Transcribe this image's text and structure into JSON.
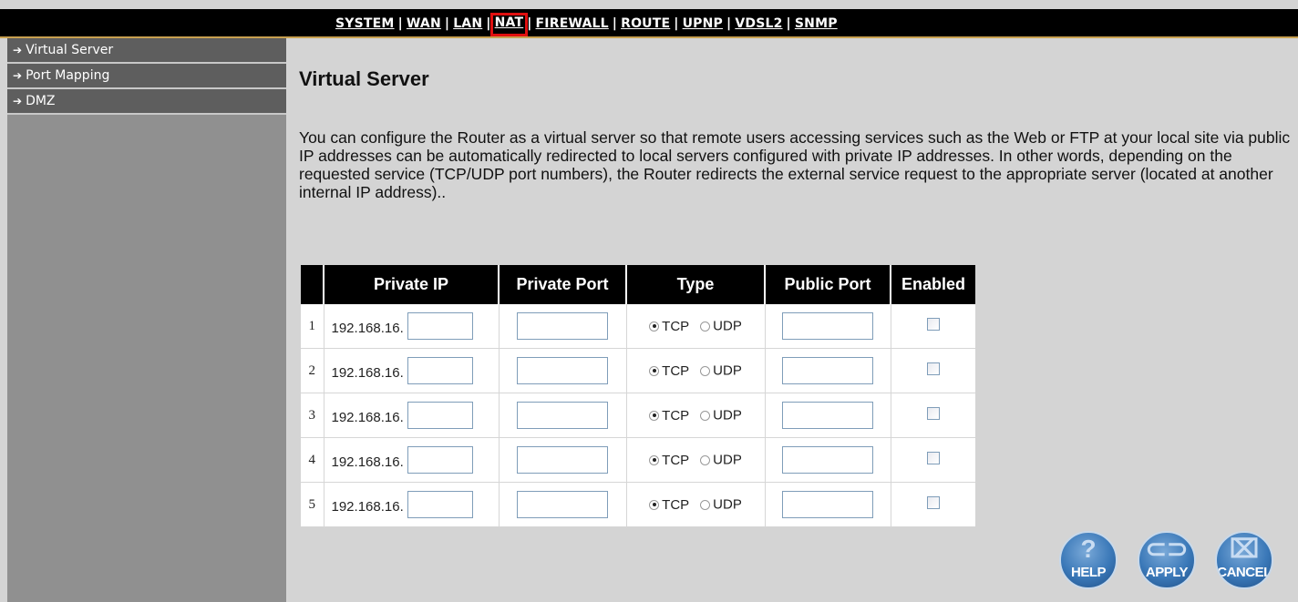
{
  "topnav": {
    "items": [
      "SYSTEM",
      "WAN",
      "LAN",
      "NAT",
      "FIREWALL",
      "ROUTE",
      "UPNP",
      "VDSL2",
      "SNMP"
    ],
    "active": "NAT"
  },
  "sidebar": {
    "items": [
      {
        "label": "Virtual Server"
      },
      {
        "label": "Port Mapping"
      },
      {
        "label": "DMZ"
      }
    ]
  },
  "main": {
    "title": "Virtual Server",
    "description": "You can configure the Router as a virtual server so that remote users accessing services such as the Web or FTP at your local site via public IP addresses can be automatically redirected to local servers configured with private IP addresses. In other words, depending on the requested service (TCP/UDP port numbers), the Router redirects the external service request to the appropriate server (located at another internal IP address).."
  },
  "table": {
    "headers": [
      "",
      "Private IP",
      "Private Port",
      "Type",
      "Public Port",
      "Enabled"
    ],
    "ip_prefix": "192.168.16.",
    "tcp_label": "TCP",
    "udp_label": "UDP",
    "rows": [
      {
        "num": "1",
        "private_ip": "",
        "private_port": "",
        "type": "TCP",
        "public_port": "",
        "enabled": false
      },
      {
        "num": "2",
        "private_ip": "",
        "private_port": "",
        "type": "TCP",
        "public_port": "",
        "enabled": false
      },
      {
        "num": "3",
        "private_ip": "",
        "private_port": "",
        "type": "TCP",
        "public_port": "",
        "enabled": false
      },
      {
        "num": "4",
        "private_ip": "",
        "private_port": "",
        "type": "TCP",
        "public_port": "",
        "enabled": false
      },
      {
        "num": "5",
        "private_ip": "",
        "private_port": "",
        "type": "TCP",
        "public_port": "",
        "enabled": false
      }
    ]
  },
  "buttons": {
    "help": "HELP",
    "apply": "APPLY",
    "cancel": "CANCEL"
  },
  "colors": {
    "nav_bar": "#000000",
    "sidebar_item": "#5e5e5e",
    "sidebar_bg": "#909090",
    "page_bg": "#d4d4d4",
    "active_highlight": "#e01010",
    "button_blue": "#3a78b8"
  }
}
